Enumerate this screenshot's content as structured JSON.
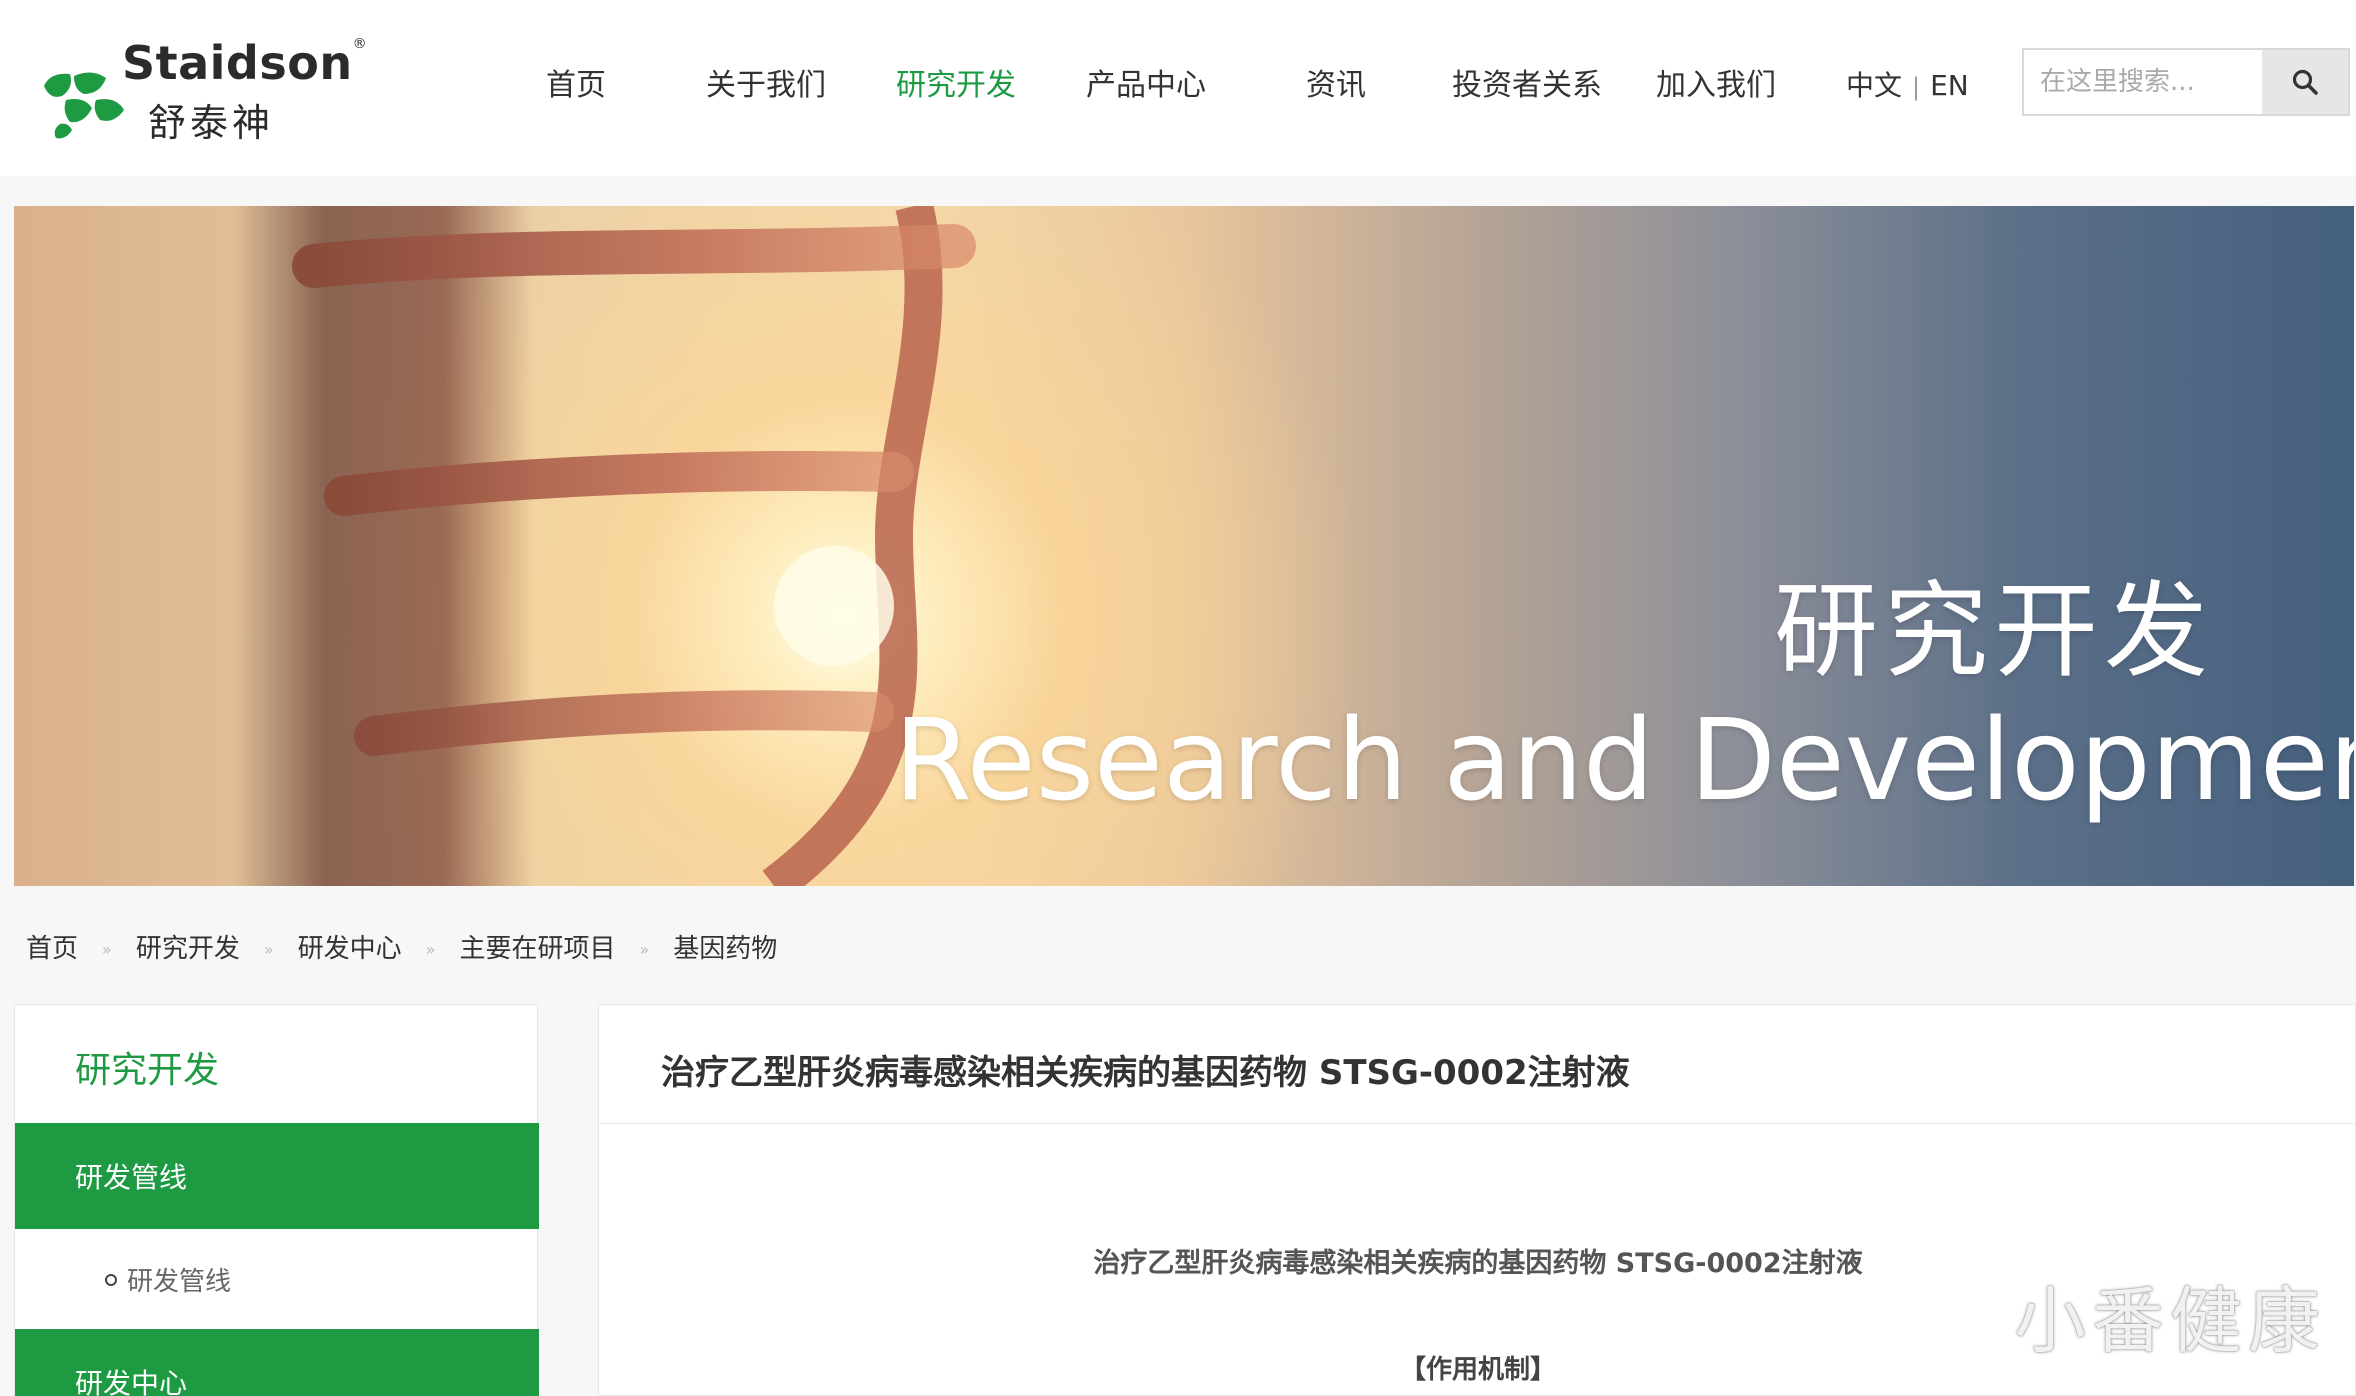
{
  "brand": {
    "name_en": "Staidson",
    "reg_mark": "®",
    "name_cn": "舒泰神",
    "color": "#1e9a43"
  },
  "nav": {
    "items": [
      {
        "label": "首页"
      },
      {
        "label": "关于我们"
      },
      {
        "label": "研究开发",
        "active": true
      },
      {
        "label": "产品中心"
      },
      {
        "label": "资讯"
      },
      {
        "label": "投资者关系"
      },
      {
        "label": "加入我们"
      }
    ]
  },
  "lang": {
    "cn": "中文",
    "sep": "|",
    "en": "EN"
  },
  "search": {
    "placeholder": "在这里搜索...",
    "icon": "search-icon"
  },
  "banner": {
    "title_cn": "研究开发",
    "title_en": "Research and Development"
  },
  "breadcrumb": [
    "首页",
    "研究开发",
    "研发中心",
    "主要在研项目",
    "基因药物"
  ],
  "breadcrumb_sep": "»",
  "sidebar": {
    "title": "研究开发",
    "items": [
      {
        "label": "研发管线"
      },
      {
        "label": "研发中心"
      }
    ],
    "sub_items": [
      {
        "label": "研发管线"
      }
    ]
  },
  "main": {
    "title": "治疗乙型肝炎病毒感染相关疾病的基因药物 STSG-0002注射液",
    "content_heading": "治疗乙型肝炎病毒感染相关疾病的基因药物 STSG-0002注射液",
    "section_label": "【作用机制】"
  },
  "watermark": "小番健康"
}
